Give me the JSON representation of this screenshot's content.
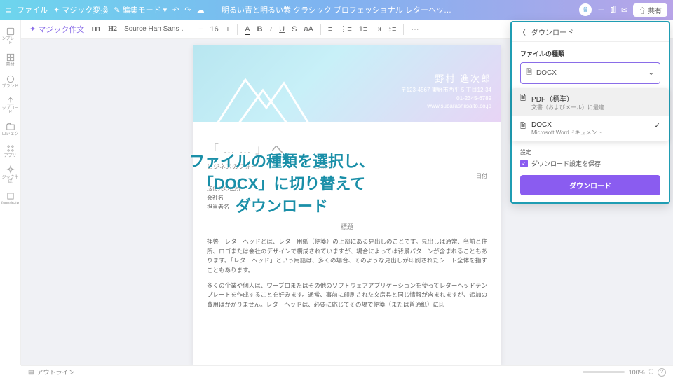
{
  "topbar": {
    "file": "ファイル",
    "magic": "マジック変換",
    "edit_mode": "編集モード",
    "doc_title": "明るい青と明るい紫 クラシック プロフェッショナル レターヘッ…",
    "share": "共有"
  },
  "sidebar": {
    "items": [
      {
        "label": "ンプレート"
      },
      {
        "label": "素材"
      },
      {
        "label": "ブランド"
      },
      {
        "label": "ップロード"
      },
      {
        "label": "ロジェク"
      },
      {
        "label": "アプリ"
      },
      {
        "label": "ジック生成"
      },
      {
        "label": "foundrate"
      }
    ]
  },
  "toolbar": {
    "magic_write": "マジック作文",
    "h1": "H1",
    "h2": "H2",
    "font": "Source Han Sans …",
    "size_minus": "−",
    "size": "16",
    "size_plus": "+",
    "a": "A",
    "b": "B",
    "i": "I",
    "u": "U",
    "s": "S"
  },
  "document": {
    "name": "野村 進次郎",
    "address": "〒123-4567 東野市西平 5 丁目12-34",
    "phone": "01-2345-6789",
    "web": "www.subarashiisaito.co.jp",
    "greeting": "「……」へ",
    "bizline": "ビジネスのフォー　　　　　　　　　しまず",
    "date_label": "日付",
    "addr1": "送付先の住所",
    "addr2": "会社名",
    "addr3": "担当者名",
    "heading": "標題",
    "para1": "拝啓　レターヘッドとは、レター用紙（便箋）の上部にある見出しのことです。見出しは通常、名前と住所、ロゴまたは会社のデザインで構成されていますが、場合によっては背景パターンが含まれることもあります。「レターヘッド」という用語は、多くの場合、そのような見出しが印刷されたシート全体を指すこともあります。",
    "para2": "多くの企業や個人は、ワープロまたはその他のソフトウェアアプリケーションを使ってレターヘッドテンプレートを作成することを好みます。通常、事前に印刷された文房具と同じ情報が含まれますが、追加の費用はかかりません。レターヘッドは、必要に応じてその場で便箋（または普通紙）に印"
  },
  "download": {
    "back": "ダウンロード",
    "filetype_label": "ファイルの種類",
    "selected": "DOCX",
    "options": [
      {
        "title": "PDF（標準）",
        "sub": "文書（およびメール）に最適"
      },
      {
        "title": "DOCX",
        "sub": "Microsoft Wordドキュメント"
      }
    ],
    "settings_label": "設定",
    "save_settings": "ダウンロード設定を保存",
    "button": "ダウンロード"
  },
  "annotation": {
    "line1": "ファイルの種類を選択し、",
    "line2": "「DOCX」に切り替えて",
    "line3": "ダウンロード"
  },
  "footer": {
    "outline": "アウトライン",
    "zoom": "100%"
  }
}
